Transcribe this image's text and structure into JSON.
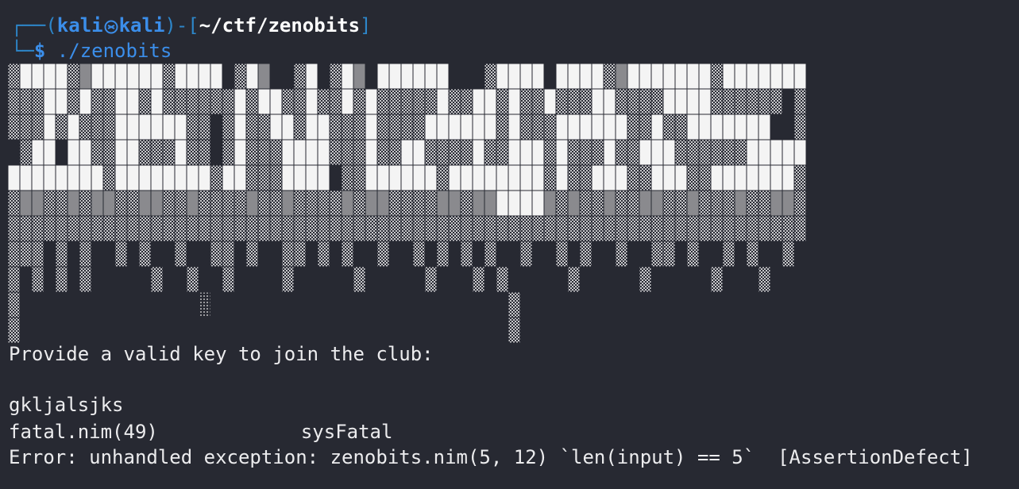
{
  "terminal": {
    "prompt": {
      "frame_top": "┌──(",
      "user": "kali",
      "host": "kali",
      "frame_mid": ")-[",
      "cwd": "~/ctf/zenobits",
      "frame_end": "]",
      "frame_bottom": "└─",
      "dollar": "$",
      "command": " ./zenobits"
    },
    "output": {
      "prompt_message": "Provide a valid key to join the club:",
      "user_input": "gkljalsjks",
      "trace_location": "fatal.nim(49)",
      "trace_proc": "sysFatal",
      "error_line": "Error: unhandled exception: zenobits.nim(5, 12) `len(input) == 5`  [AssertionDefect]"
    }
  },
  "colors": {
    "background": "#272932",
    "prompt_blue": "#3b8eea",
    "frame_blue": "#2d86c9",
    "text": "#ececee",
    "banner_white": "#f4f4f4",
    "banner_gray": "#8a8a8e"
  }
}
